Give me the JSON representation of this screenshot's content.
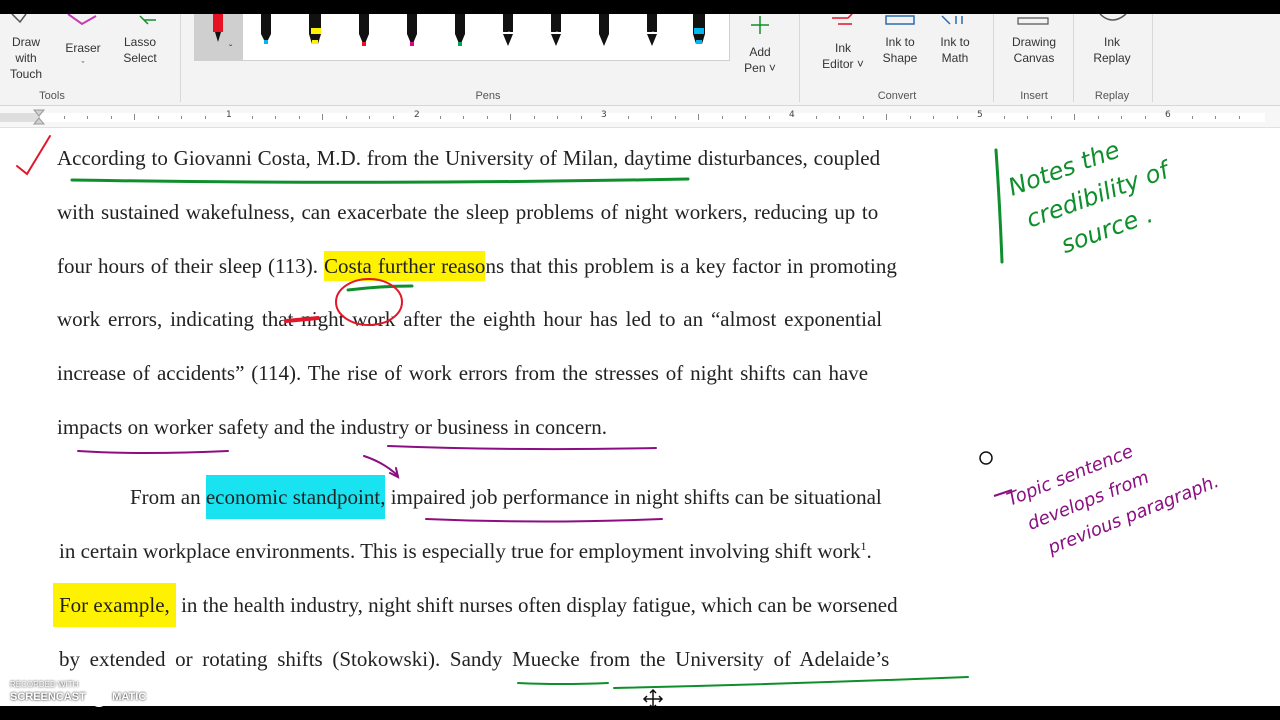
{
  "ribbon": {
    "tools": {
      "draw_with_touch": [
        "Draw with",
        "Touch"
      ],
      "eraser": "Eraser",
      "lasso": [
        "Lasso",
        "Select"
      ],
      "group_label": "Tools"
    },
    "pens": {
      "group_label": "Pens",
      "add_pen": [
        "Add",
        "Pen ˅"
      ],
      "colors": [
        "#e81123",
        "#000000",
        "#fff100",
        "#e81123",
        "#e3008c",
        "#00a651",
        "#ffffff",
        "#ffffff",
        "#000000",
        "#ffffff",
        "#00b7ef"
      ]
    },
    "convert": {
      "group_label": "Convert",
      "ink_editor": [
        "Ink",
        "Editor ˅"
      ],
      "ink_to_shape": [
        "Ink to",
        "Shape"
      ],
      "ink_to_math": [
        "Ink to",
        "Math"
      ]
    },
    "insert": {
      "group_label": "Insert",
      "drawing_canvas": [
        "Drawing",
        "Canvas"
      ]
    },
    "replay": {
      "group_label": "Replay",
      "ink_replay": [
        "Ink",
        "Replay"
      ]
    }
  },
  "ruler": {
    "numbers": [
      "1",
      "2",
      "3",
      "4",
      "5",
      "6"
    ]
  },
  "document": {
    "p1": {
      "l1": "According to Giovanni Costa, M.D. from the University of Milan, daytime disturbances, coupled",
      "l2": "with sustained wakefulness, can exacerbate the sleep problems of night workers, reducing up to",
      "l3a": "four hours of their sleep (113). ",
      "l3b": "Costa further reaso",
      "l3c": "ns that this problem is a key factor in promoting",
      "l4": "work errors, indicating that night work after the eighth hour has led to an “almost exponential",
      "l5": "increase of accidents” (114). The rise of work errors from the stresses of night shifts can have",
      "l6": "impacts on worker safety and the industry or business in concern."
    },
    "p2": {
      "l1a": "From an ",
      "l1b": "economic standpoint,",
      "l1c": " impaired job performance in night shifts can be situational",
      "l2": "in certain workplace environments. This is especially true for employment involving shift work",
      "l2_sup": "1",
      "l2_end": ".",
      "l3a": "For example,",
      "l3b": " in the health industry, night shift nurses often display fatigue, which can be worsened",
      "l4": "by extended or rotating shifts (Stokowski). Sandy Muecke from the University of Adelaide’s"
    }
  },
  "annotations": {
    "green_note": [
      "Notes the",
      "credibility of",
      "source ."
    ],
    "purple_note": [
      "Topic sentence",
      "develops from",
      "previous paragraph."
    ],
    "colors": {
      "green": "#0e8f2c",
      "purple": "#8b0f83",
      "red": "#e0182a"
    }
  },
  "watermark": {
    "line1": "RECORDED WITH",
    "line2": "SCREENCAST",
    "line3": "MATIC"
  }
}
